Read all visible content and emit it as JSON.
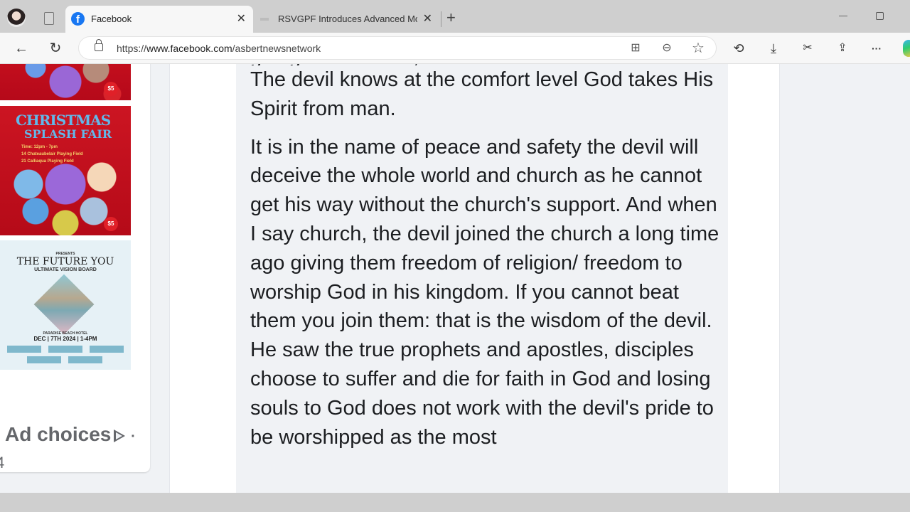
{
  "browser": {
    "tabs": [
      {
        "title": "Facebook",
        "favicon": "facebook-icon",
        "active": true
      },
      {
        "title": "RSVGPF Introduces Advanced Mo",
        "favicon": "generic-favicon",
        "active": false
      }
    ],
    "close_glyph": "✕",
    "new_tab_glyph": "+",
    "url_prefix": "https://",
    "url_host": "www.facebook.com",
    "url_path": "/asbertnewsnetwork",
    "toolbar_glyphs": {
      "back": "←",
      "refresh": "↻",
      "apps": "⊞",
      "zoom_out": "⊖",
      "favorite": "☆",
      "history": "⟲",
      "downloads": "⤓",
      "screenshot": "✂",
      "share": "⇪",
      "more": "···"
    }
  },
  "sidebar": {
    "ads": [
      {
        "name": "christmas-splash-fair-ad-top",
        "price": "$5"
      },
      {
        "name": "christmas-splash-fair-ad",
        "title_line1": "CHRISTMAS",
        "title_line2": "SPLASH FAIR",
        "time": "Time: 12pm - 7pm",
        "venue1": "14 Chateaubelair Playing Field",
        "venue2": "21 Calliaqua Playing Field",
        "price": "$5"
      },
      {
        "name": "future-you-conference-ad",
        "presents": "PRESENTS",
        "title": "THE FUTURE YOU",
        "subtitle": "ULTIMATE VISION BOARD",
        "venue": "PARADISE BEACH HOTEL",
        "date": "DEC | 7TH 2024 | 1-4PM"
      }
    ],
    "ad_choices_label": "Ad choices",
    "separator": "·",
    "partial_number": "4"
  },
  "post": {
    "clipped_top_line": "going to be boiled, that is how the devil works.",
    "paragraphs": [
      "The devil knows at the comfort level God takes His Spirit from man.",
      "It is in the name of peace and safety the devil will deceive the whole world and church as he cannot get his way without the church's support. And when I say church, the devil joined the church a long time ago giving them freedom of religion/ freedom to worship God in his kingdom. If you cannot beat them you join them: that is the wisdom of the devil. He saw the true prophets and apostles, disciples choose to suffer and die for faith in God and losing souls to God does not work with the devil's pride to be worshipped as the most"
    ]
  }
}
